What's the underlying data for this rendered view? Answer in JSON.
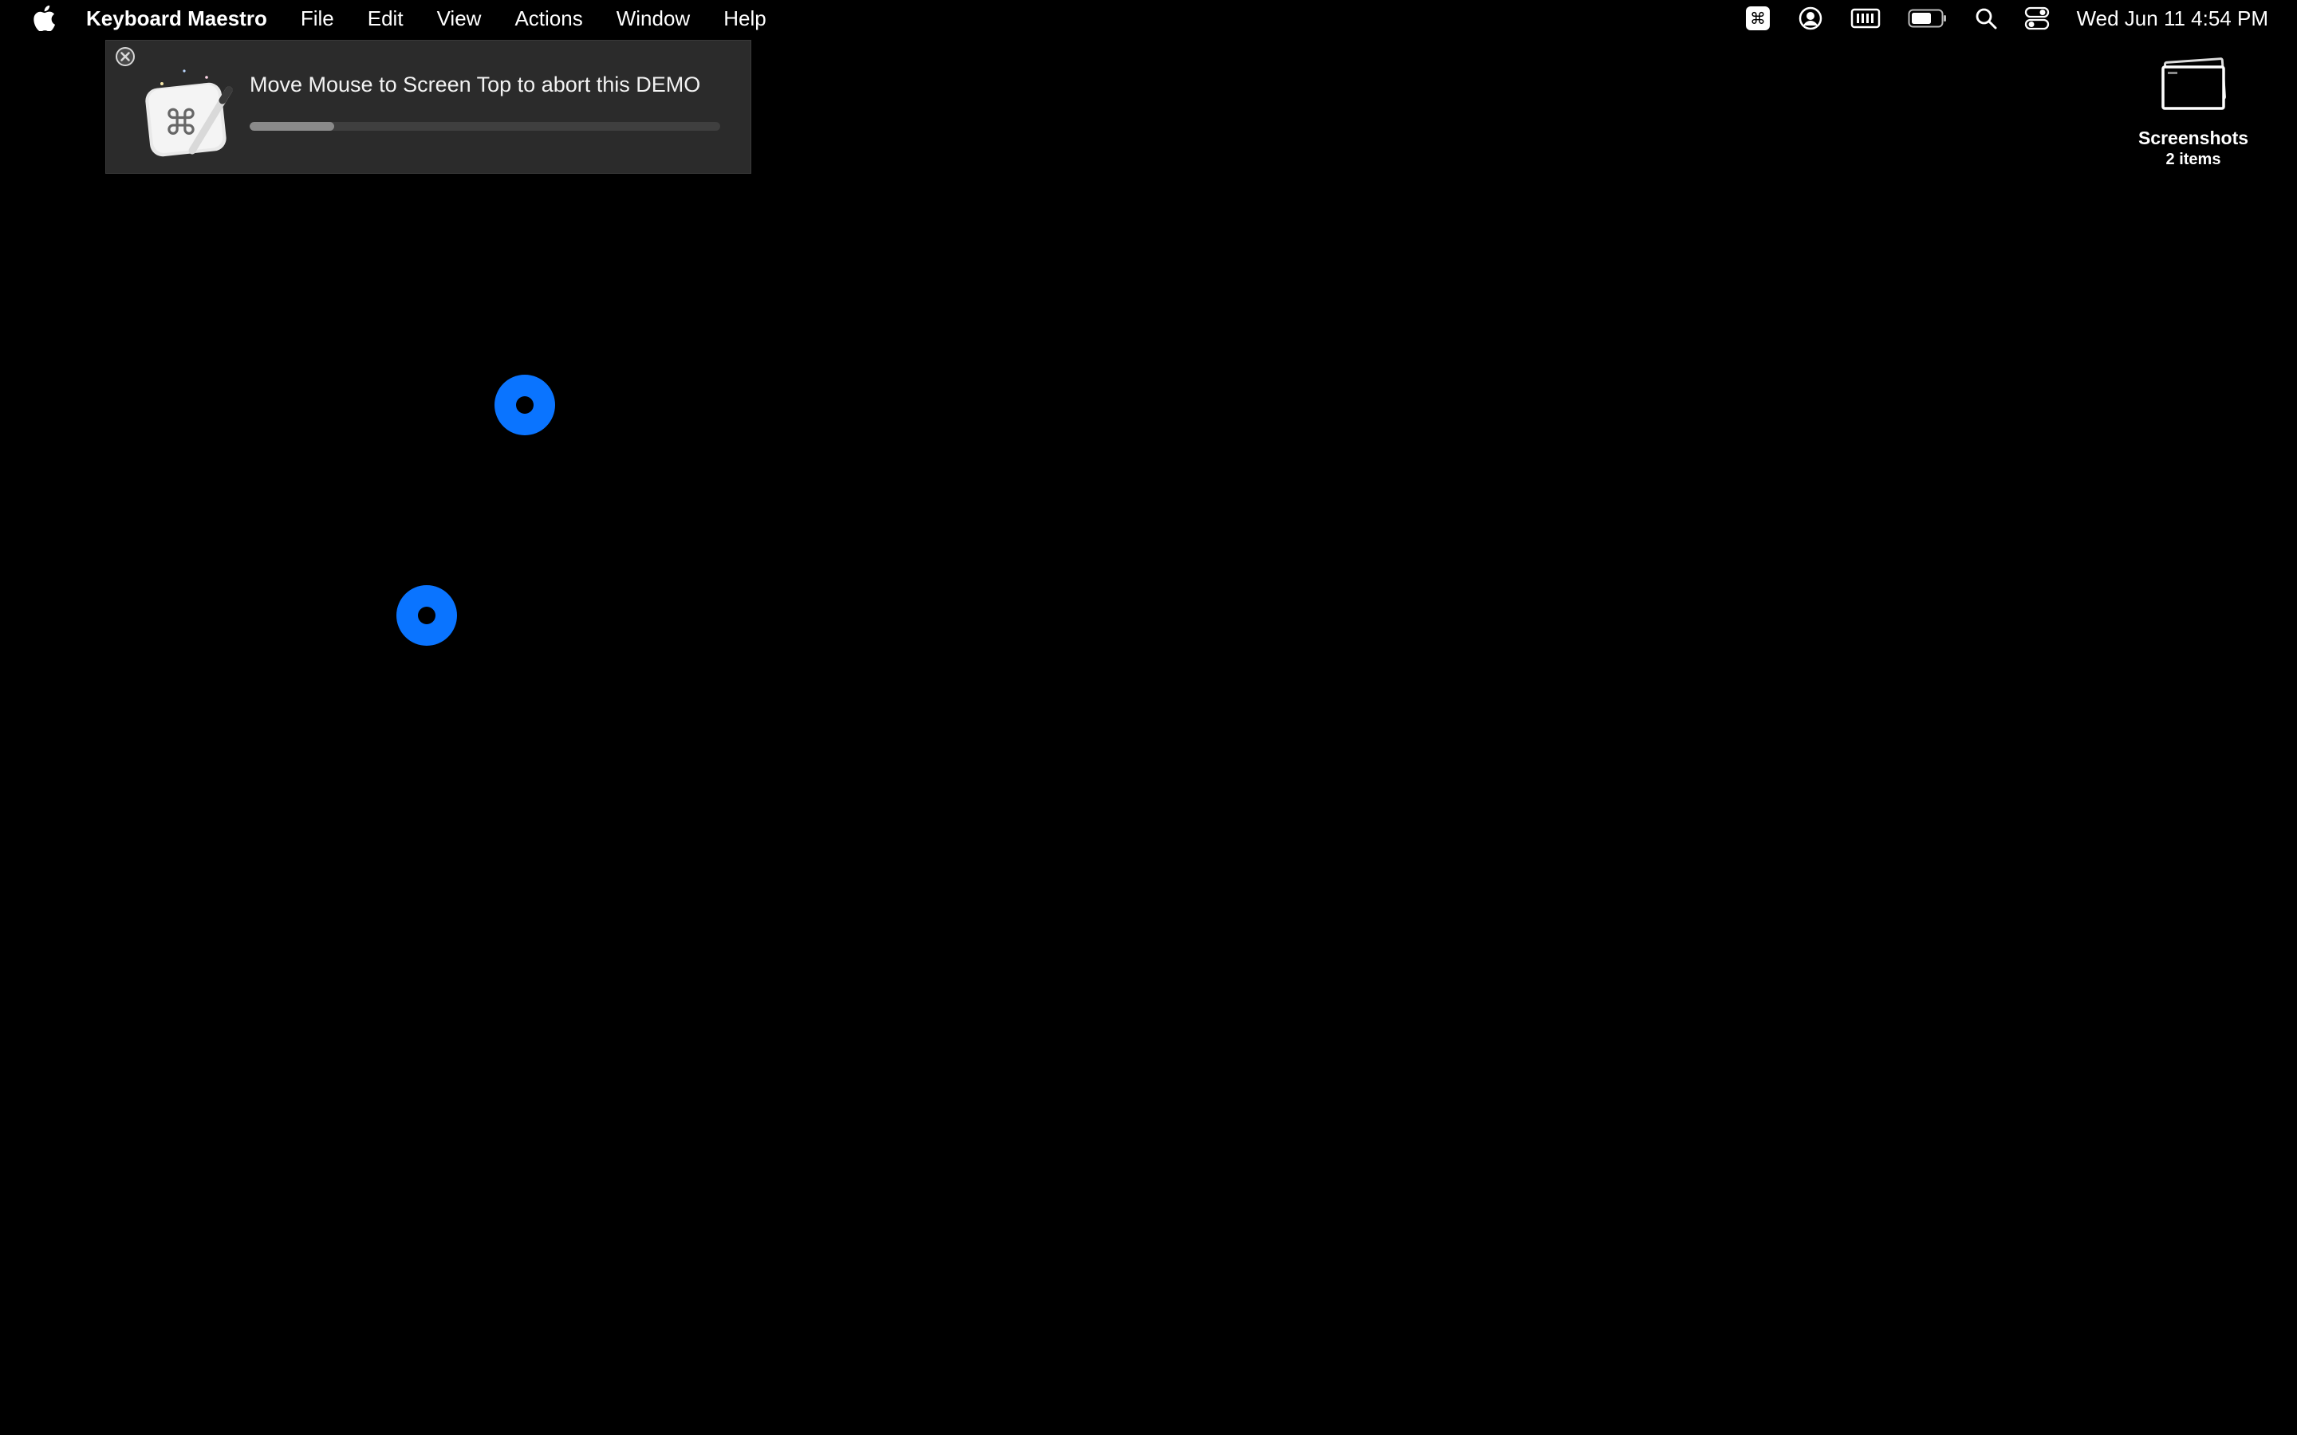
{
  "menubar": {
    "app_name": "Keyboard Maestro",
    "items": [
      "File",
      "Edit",
      "View",
      "Actions",
      "Window",
      "Help"
    ],
    "status_icons": [
      "keyboard-maestro-icon",
      "user-account-icon",
      "memory-icon",
      "battery-icon",
      "spotlight-search-icon",
      "control-center-icon"
    ],
    "clock": "Wed Jun 11  4:54 PM"
  },
  "hud": {
    "message": "Move Mouse to Screen Top to abort this DEMO",
    "progress": 0.18
  },
  "desktop": {
    "items": [
      {
        "name": "Screenshots",
        "subtitle": "2 items",
        "icon": "folder-icon"
      }
    ]
  },
  "colors": {
    "background": "#000000",
    "click_marker": "#0a74ff",
    "hud_background": "#2b2b2b"
  }
}
